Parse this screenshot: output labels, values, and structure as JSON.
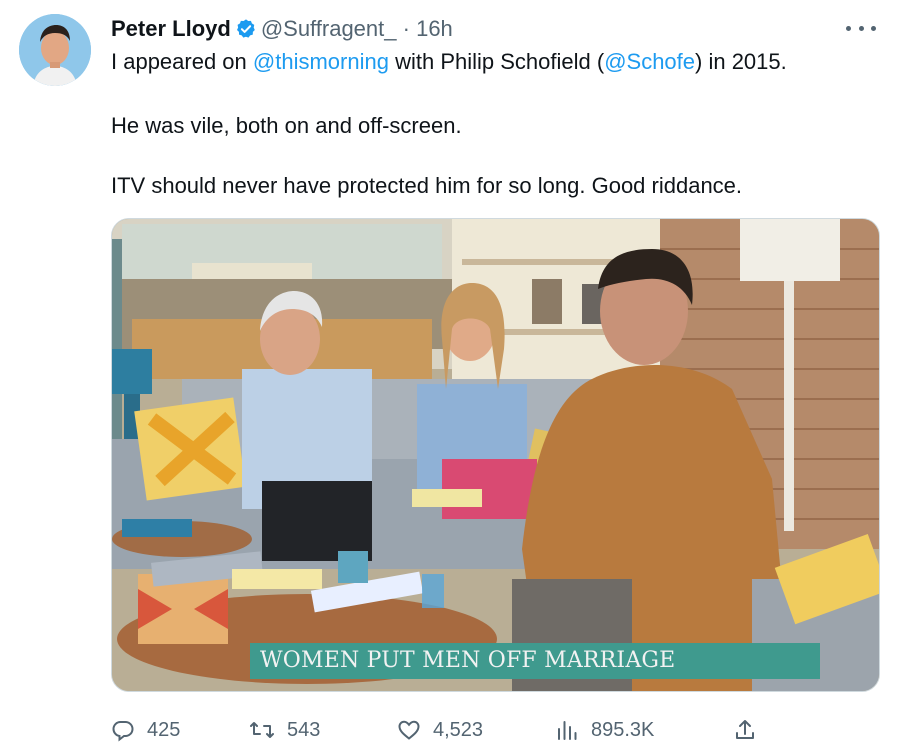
{
  "tweet": {
    "author_name": "Peter Lloyd",
    "handle": "@Suffragent_",
    "separator": "·",
    "time": "16h",
    "verified": true,
    "text": {
      "p1_before": "I appeared on ",
      "p1_mention1": "@thismorning",
      "p1_middle": " with Philip Schofield (",
      "p1_mention2": "@Schofe",
      "p1_after": ") in 2015.",
      "p2": "He was vile, both on and off-screen.",
      "p3": "ITV should never have protected him for so long. Good riddance."
    },
    "media": {
      "caption": "WOMEN PUT MEN OFF MARRIAGE"
    },
    "actions": {
      "replies": "425",
      "retweets": "543",
      "likes": "4,523",
      "views": "895.3K"
    }
  },
  "icons": {
    "verified": "verified-badge-icon",
    "more": "more-options-icon",
    "reply": "reply-icon",
    "retweet": "retweet-icon",
    "like": "heart-icon",
    "views": "views-chart-icon",
    "share": "share-icon"
  },
  "colors": {
    "link": "#1d9bf0",
    "muted": "#536471",
    "text": "#0f1419",
    "caption_bg": "#3f9a8e"
  }
}
